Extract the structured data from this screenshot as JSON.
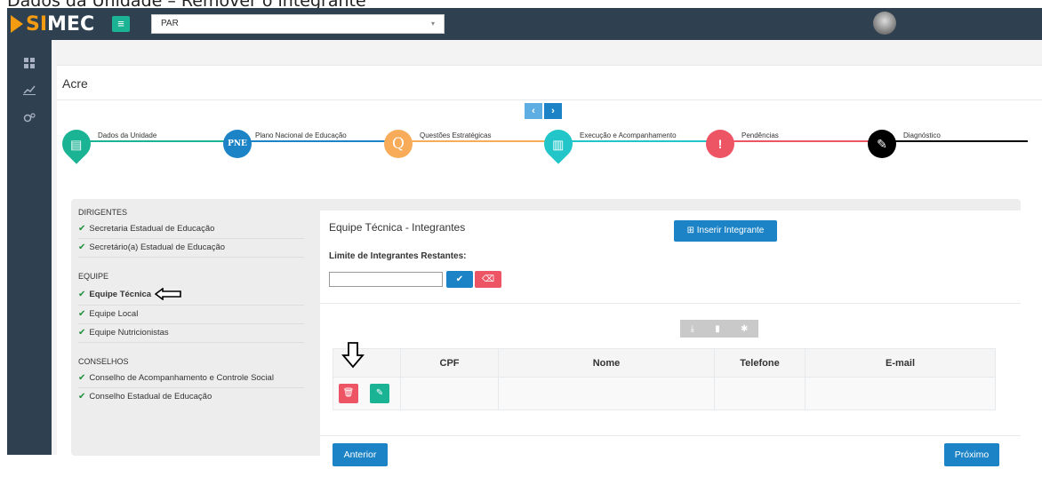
{
  "caption": "Dados da Unidade – Remover o integrante",
  "brand": {
    "logo_text_a": "SI",
    "logo_text_b": "MEC",
    "orange": "#f39c12"
  },
  "header": {
    "system_select_value": "PAR",
    "caret": "▾"
  },
  "sidebar": {
    "icons": [
      "grid-icon",
      "chart-line-icon",
      "gears-icon"
    ]
  },
  "page": {
    "state_title": "Acre"
  },
  "pager": {
    "prev": "‹",
    "next": "›"
  },
  "steps": [
    {
      "label": "Dados da Unidade",
      "glyph": "▤",
      "color": "#1ab394"
    },
    {
      "label": "Plano Nacional de Educação",
      "glyph": "PNE",
      "color": "#1c84c6"
    },
    {
      "label": "Questões Estratégicas",
      "glyph": "Q",
      "color": "#f8ac59"
    },
    {
      "label": "Execução e Acompanhamento",
      "glyph": "▥",
      "color": "#23c6c8"
    },
    {
      "label": "Pendências",
      "glyph": "!",
      "color": "#ed5565"
    },
    {
      "label": "Diagnóstico",
      "glyph": "✎",
      "color": "#000000"
    }
  ],
  "left_menu": {
    "groups": [
      {
        "title": "DIRIGENTES",
        "items": [
          "Secretaria Estadual de Educação",
          "Secretário(a) Estadual de Educação"
        ]
      },
      {
        "title": "EQUIPE",
        "items": [
          "Equipe Técnica",
          "Equipe Local",
          "Equipe Nutricionistas"
        ]
      },
      {
        "title": "CONSELHOS",
        "items": [
          "Conselho de Acompanhamento e Controle Social",
          "Conselho Estadual de Educação"
        ]
      }
    ],
    "check": "✔"
  },
  "card": {
    "title": "Equipe Técnica - Integrantes",
    "insert_button": "⊞ Inserir Integrante",
    "limit_label": "Limite de Integrantes Restantes:",
    "limit_value": "",
    "confirm_glyph": "✔",
    "clear_glyph": "⌫"
  },
  "toolbar": {
    "download": "⤓",
    "file": "▮",
    "settings": "✱"
  },
  "table": {
    "columns": [
      "",
      "CPF",
      "Nome",
      "Telefone",
      "E-mail"
    ],
    "rows": [
      {
        "cpf": "",
        "nome": "",
        "telefone": "",
        "email": ""
      }
    ],
    "delete_glyph": "🗑",
    "edit_glyph": "✎"
  },
  "footer": {
    "prev_button": "Anterior",
    "next_button": "Próximo"
  },
  "float_button": "⚙"
}
